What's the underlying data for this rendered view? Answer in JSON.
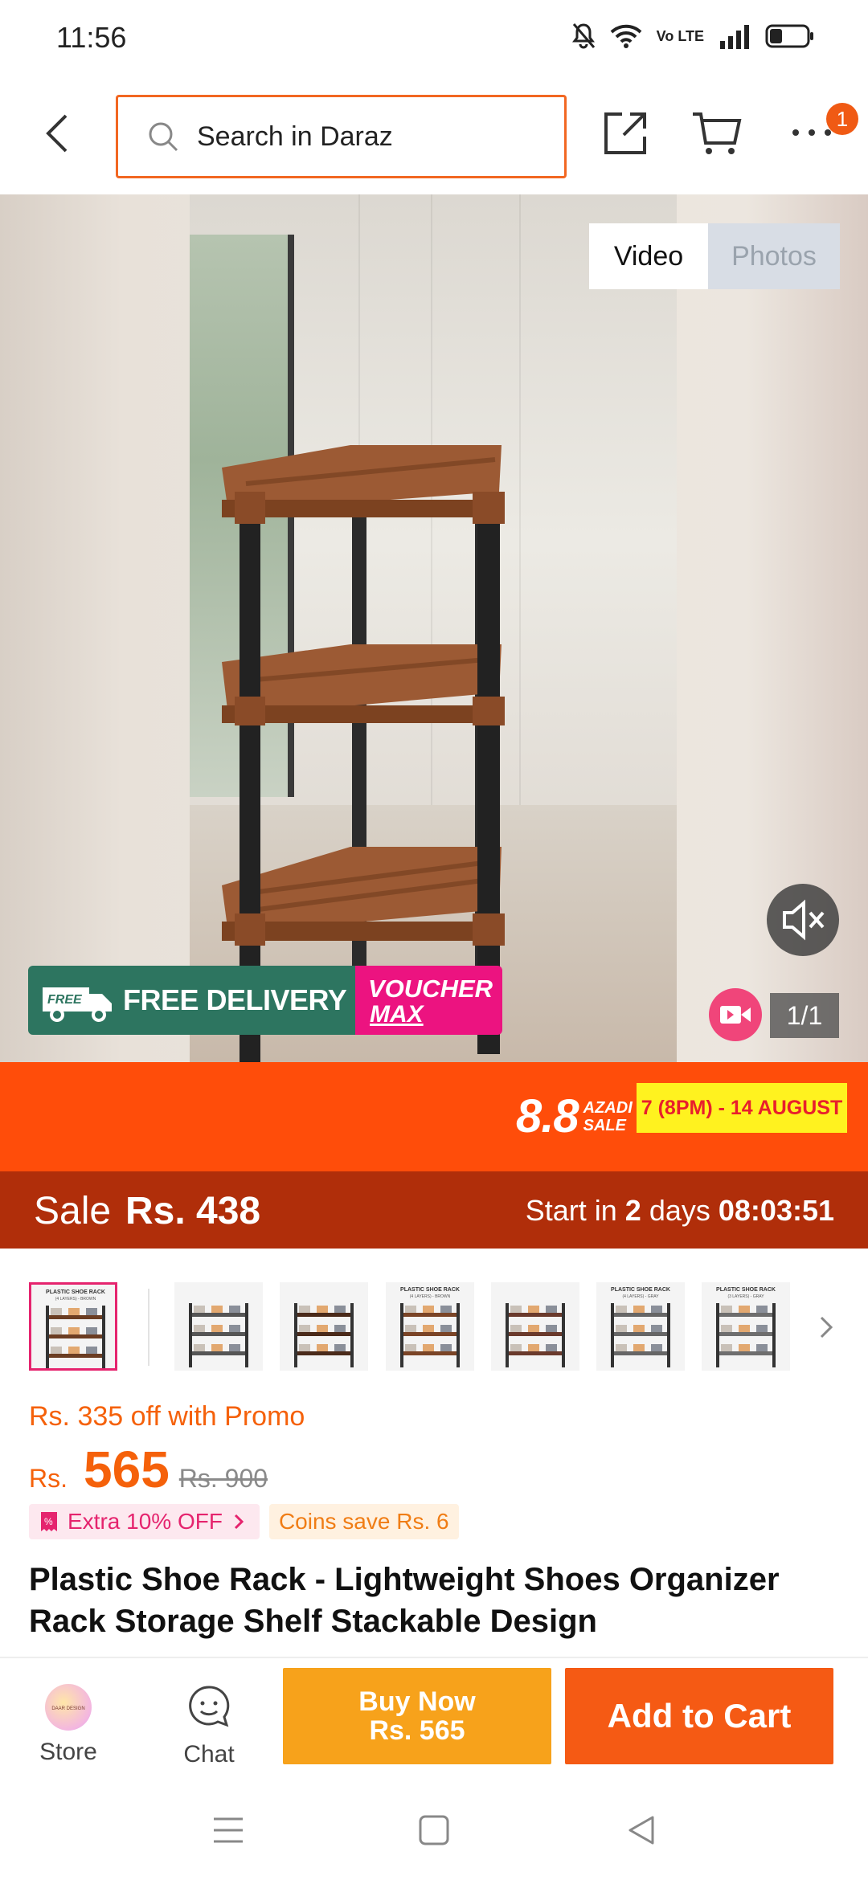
{
  "status_bar": {
    "time": "11:56",
    "network_label": "Vo LTE",
    "battery_level": 0.35
  },
  "nav": {
    "search_placeholder": "Search in Daraz",
    "more_badge": "1"
  },
  "media": {
    "tabs": {
      "video": "Video",
      "photos": "Photos"
    },
    "active_tab": "Video",
    "free_delivery": "FREE DELIVERY",
    "free_tag": "FREE",
    "voucher_line1": "VOUCHER",
    "voucher_line2": "MAX",
    "counter": "1/1"
  },
  "sale_banner": {
    "brand_big": "8.8",
    "brand_small_1": "AZADI",
    "brand_small_2": "SALE",
    "dates": "7 (8PM) - 14 AUGUST"
  },
  "sale_bar": {
    "label": "Sale",
    "price": "Rs. 438",
    "starts_prefix": "Start in",
    "starts_days": "2",
    "starts_suffix": "days",
    "countdown": "08:03:51"
  },
  "thumbnails": [
    {
      "caption": "PLASTIC SHOE RACK",
      "sub": "(4 LAYERS) - BROWN",
      "tone": "#6b3d22"
    },
    {
      "caption": "",
      "sub": "",
      "tone": "#555555"
    },
    {
      "caption": "",
      "sub": "",
      "tone": "#4a2a1a"
    },
    {
      "caption": "PLASTIC SHOE RACK",
      "sub": "(4 LAYERS) - BROWN",
      "tone": "#7a4426"
    },
    {
      "caption": "",
      "sub": "",
      "tone": "#6a3a2c"
    },
    {
      "caption": "PLASTIC SHOE RACK",
      "sub": "(4 LAYERS) - GRAY",
      "tone": "#666666"
    },
    {
      "caption": "PLASTIC SHOE RACK",
      "sub": "(3 LAYERS) - GRAY",
      "tone": "#6e6e6e"
    }
  ],
  "pricing": {
    "promo": "Rs. 335 off with Promo",
    "currency": "Rs.",
    "price": "565",
    "original_price": "Rs. 900",
    "extra_off": "Extra 10% OFF",
    "coins": "Coins save Rs. 6"
  },
  "product": {
    "title": "Plastic Shoe Rack - Lightweight Shoes Organizer Rack Storage Shelf Stackable Design"
  },
  "actions": {
    "store": "Store",
    "store_avatar_text": "DAAR DESIGN",
    "chat": "Chat",
    "buy_now_line1": "Buy Now",
    "buy_now_line2": "Rs. 565",
    "add_to_cart": "Add to Cart"
  },
  "colors": {
    "brand_orange": "#f55a14",
    "sale_red": "#b02e0a",
    "buy_now": "#f7a21b",
    "promo_pink": "#e5246e",
    "free_delivery_green": "#2d7560"
  }
}
